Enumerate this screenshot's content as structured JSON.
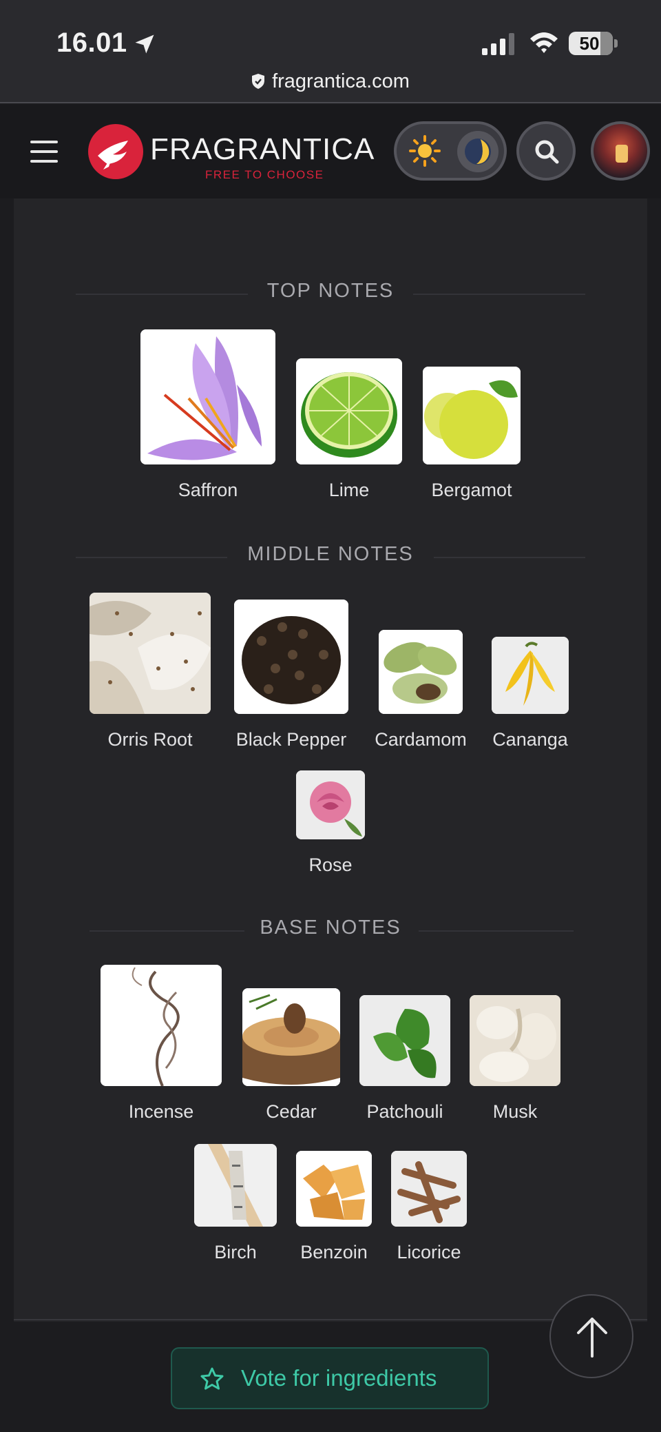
{
  "status_bar": {
    "time": "16.01",
    "battery": "50",
    "url": "fragrantica.com"
  },
  "header": {
    "brand": "FRAGRANTICA",
    "tagline": "FREE TO CHOOSE",
    "brand_color": "#d9233b"
  },
  "pyramid": {
    "top": {
      "title": "TOP NOTES",
      "notes": [
        "Saffron",
        "Lime",
        "Bergamot"
      ]
    },
    "middle": {
      "title": "MIDDLE NOTES",
      "notes": [
        "Orris Root",
        "Black Pepper",
        "Cardamom",
        "Cananga",
        "Rose"
      ]
    },
    "base": {
      "title": "BASE NOTES",
      "notes": [
        "Incense",
        "Cedar",
        "Patchouli",
        "Musk",
        "Birch",
        "Benzoin",
        "Licorice"
      ]
    }
  },
  "actions": {
    "vote_label": "Vote for ingredients",
    "accent_color": "#3ec9a7"
  },
  "icons": [
    "location-arrow-icon",
    "signal-icon",
    "wifi-icon",
    "battery-icon",
    "shield-icon",
    "hamburger-icon",
    "sun-icon",
    "moon-icon",
    "search-icon",
    "star-icon",
    "arrow-up-icon"
  ]
}
